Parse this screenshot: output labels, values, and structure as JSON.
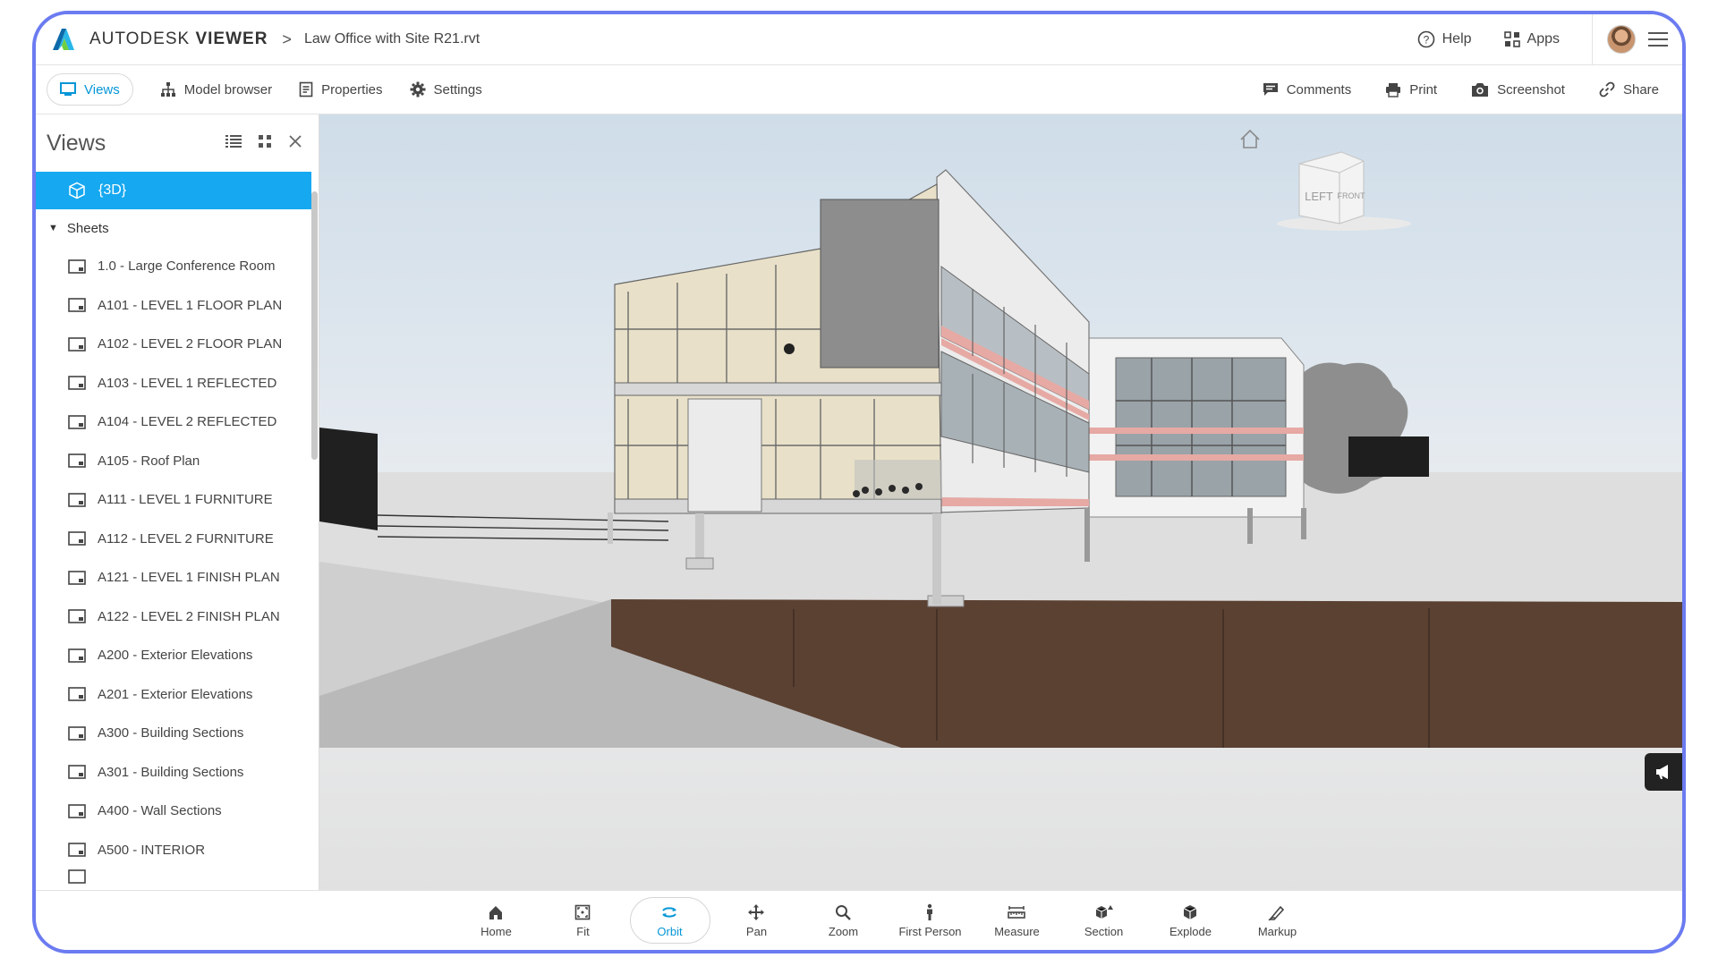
{
  "app": {
    "brand_regular": "AUTODESK",
    "brand_bold": "VIEWER",
    "breadcrumb_separator": ">",
    "file_name": "Law Office with Site R21.rvt"
  },
  "topbar": {
    "help_label": "Help",
    "apps_label": "Apps"
  },
  "toolbar": {
    "views_label": "Views",
    "model_browser_label": "Model browser",
    "properties_label": "Properties",
    "settings_label": "Settings",
    "comments_label": "Comments",
    "print_label": "Print",
    "screenshot_label": "Screenshot",
    "share_label": "Share"
  },
  "sidebar": {
    "title": "Views",
    "selected_view": "{3D}",
    "sheets_label": "Sheets",
    "sheets": [
      "1.0 - Large Conference Room",
      "A101 - LEVEL 1 FLOOR PLAN",
      "A102 - LEVEL 2 FLOOR PLAN",
      "A103 - LEVEL 1 REFLECTED",
      "A104 - LEVEL 2 REFLECTED",
      "A105 - Roof Plan",
      "A111 - LEVEL 1 FURNITURE",
      "A112 - LEVEL 2 FURNITURE",
      "A121 - LEVEL 1 FINISH PLAN",
      "A122 - LEVEL 2 FINISH PLAN",
      "A200 - Exterior Elevations",
      "A201 - Exterior Elevations",
      "A300 - Building Sections",
      "A301 - Building Sections",
      "A400 - Wall Sections",
      "A500 - INTERIOR"
    ]
  },
  "viewcube": {
    "left_face": "LEFT",
    "front_face": "FRONT"
  },
  "navigation": {
    "tools": [
      {
        "label": "Home",
        "icon": "home-icon"
      },
      {
        "label": "Fit",
        "icon": "fit-icon"
      },
      {
        "label": "Orbit",
        "icon": "orbit-icon"
      },
      {
        "label": "Pan",
        "icon": "pan-icon"
      },
      {
        "label": "Zoom",
        "icon": "zoom-icon"
      },
      {
        "label": "First Person",
        "icon": "first-person-icon"
      },
      {
        "label": "Measure",
        "icon": "measure-icon"
      },
      {
        "label": "Section",
        "icon": "section-icon"
      },
      {
        "label": "Explode",
        "icon": "explode-icon"
      },
      {
        "label": "Markup",
        "icon": "markup-icon"
      }
    ],
    "active_tool": "Orbit"
  },
  "colors": {
    "accent": "#0696d7",
    "selected_row": "#16a8f0",
    "frame_border": "#6b7bf0"
  }
}
